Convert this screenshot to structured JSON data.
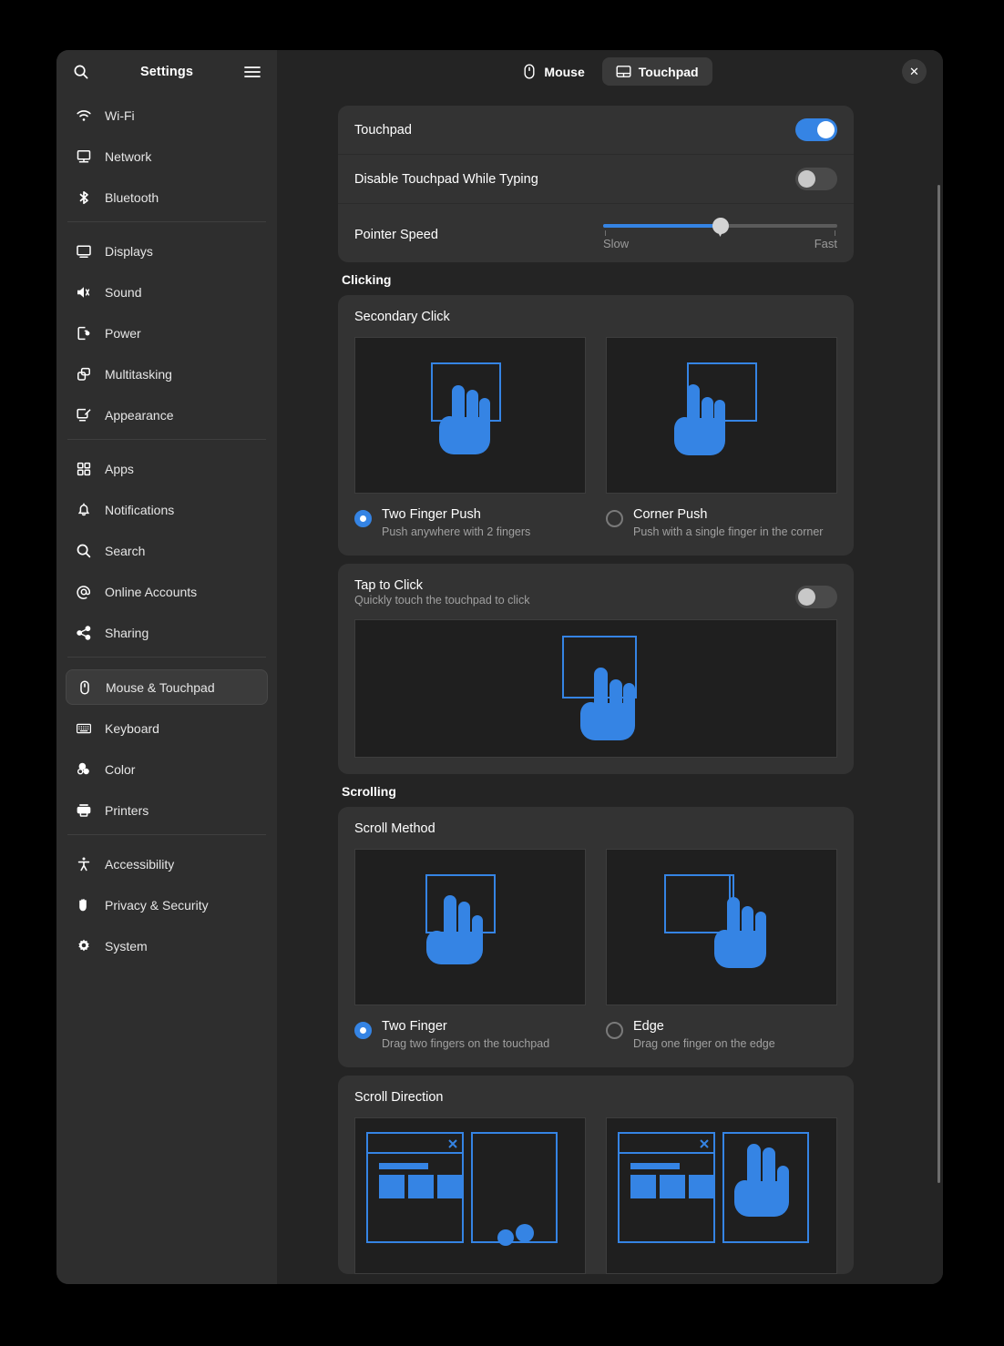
{
  "sidebar": {
    "title": "Settings",
    "search_icon": "search-icon",
    "menu_icon": "hamburger-menu-icon",
    "groups": [
      {
        "items": [
          {
            "label": "Wi-Fi",
            "icon": "wifi-icon"
          },
          {
            "label": "Network",
            "icon": "network-icon"
          },
          {
            "label": "Bluetooth",
            "icon": "bluetooth-icon"
          }
        ]
      },
      {
        "items": [
          {
            "label": "Displays",
            "icon": "display-icon"
          },
          {
            "label": "Sound",
            "icon": "sound-icon"
          },
          {
            "label": "Power",
            "icon": "power-icon"
          },
          {
            "label": "Multitasking",
            "icon": "multitasking-icon"
          },
          {
            "label": "Appearance",
            "icon": "appearance-icon"
          }
        ]
      },
      {
        "items": [
          {
            "label": "Apps",
            "icon": "apps-icon"
          },
          {
            "label": "Notifications",
            "icon": "bell-icon"
          },
          {
            "label": "Search",
            "icon": "search-icon"
          },
          {
            "label": "Online Accounts",
            "icon": "at-sign-icon"
          },
          {
            "label": "Sharing",
            "icon": "share-icon"
          }
        ]
      },
      {
        "items": [
          {
            "label": "Mouse & Touchpad",
            "icon": "mouse-icon",
            "selected": true
          },
          {
            "label": "Keyboard",
            "icon": "keyboard-icon"
          },
          {
            "label": "Color",
            "icon": "color-icon"
          },
          {
            "label": "Printers",
            "icon": "printer-icon"
          }
        ]
      },
      {
        "items": [
          {
            "label": "Accessibility",
            "icon": "accessibility-icon"
          },
          {
            "label": "Privacy & Security",
            "icon": "hand-shield-icon"
          },
          {
            "label": "System",
            "icon": "gear-icon"
          }
        ]
      }
    ]
  },
  "topbar": {
    "tabs": [
      {
        "label": "Mouse",
        "icon": "mouse-icon",
        "active": false
      },
      {
        "label": "Touchpad",
        "icon": "touchpad-icon",
        "active": true
      }
    ],
    "close_label": "✕"
  },
  "general": {
    "touchpad_label": "Touchpad",
    "touchpad_enabled": true,
    "disable_while_typing_label": "Disable Touchpad While Typing",
    "disable_while_typing_enabled": false,
    "pointer_speed_label": "Pointer Speed",
    "pointer_speed_min_label": "Slow",
    "pointer_speed_max_label": "Fast",
    "pointer_speed_percent": 50
  },
  "clicking": {
    "section_label": "Clicking",
    "secondary_click": {
      "title": "Secondary Click",
      "options": [
        {
          "name": "Two Finger Push",
          "desc": "Push anywhere with 2 fingers",
          "selected": true,
          "illustration": "two-finger-push-illustration"
        },
        {
          "name": "Corner Push",
          "desc": "Push with a single finger in the corner",
          "selected": false,
          "illustration": "corner-push-illustration"
        }
      ]
    },
    "tap_to_click": {
      "title": "Tap to Click",
      "subtitle": "Quickly touch the touchpad to click",
      "enabled": false,
      "illustration": "tap-to-click-illustration"
    }
  },
  "scrolling": {
    "section_label": "Scrolling",
    "scroll_method": {
      "title": "Scroll Method",
      "options": [
        {
          "name": "Two Finger",
          "desc": "Drag two fingers on the touchpad",
          "selected": true,
          "illustration": "two-finger-scroll-illustration"
        },
        {
          "name": "Edge",
          "desc": "Drag one finger on the edge",
          "selected": false,
          "illustration": "edge-scroll-illustration"
        }
      ]
    },
    "scroll_direction": {
      "title": "Scroll Direction",
      "options": [
        {
          "illustration": "traditional-scroll-illustration"
        },
        {
          "illustration": "natural-scroll-illustration"
        }
      ]
    }
  },
  "colors": {
    "accent": "#3584e4",
    "window_bg": "#242424",
    "sidebar_bg": "#2e2e2e",
    "card_bg": "#333333",
    "illustration_bg": "#1f1f1f"
  }
}
